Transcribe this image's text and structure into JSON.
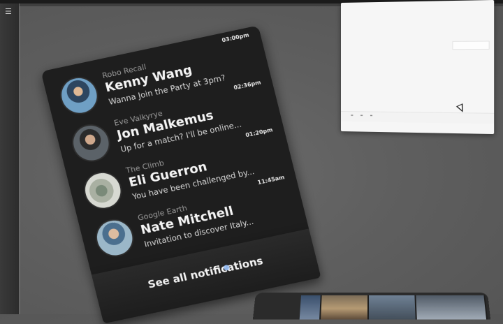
{
  "notifications": [
    {
      "app": "Robo Recall",
      "name": "Kenny Wang",
      "message": "Wanna Join the Party at 3pm?",
      "time": "03:00pm",
      "avatar": "avatar-kenny"
    },
    {
      "app": "Eve Valkyrye",
      "name": "Jon Malkemus",
      "message": "Up for a match? I'll be online...",
      "time": "02:36pm",
      "avatar": "avatar-jon"
    },
    {
      "app": "The Climb",
      "name": "Eli Guerron",
      "message": "You have been challenged by...",
      "time": "01:20pm",
      "avatar": "avatar-eli"
    },
    {
      "app": "Google Earth",
      "name": "Nate Mitchell",
      "message": "Invitation to discover Italy...",
      "time": "11:45am",
      "avatar": "avatar-nate"
    }
  ],
  "footer": {
    "see_all_label": "See all notifications"
  },
  "toolbar": {
    "menu_icon": "menu-icon"
  },
  "colors": {
    "card_bg": "#1e1e1e",
    "accent_dot": "#9fc6ff",
    "environment": "#5f5f5f"
  }
}
